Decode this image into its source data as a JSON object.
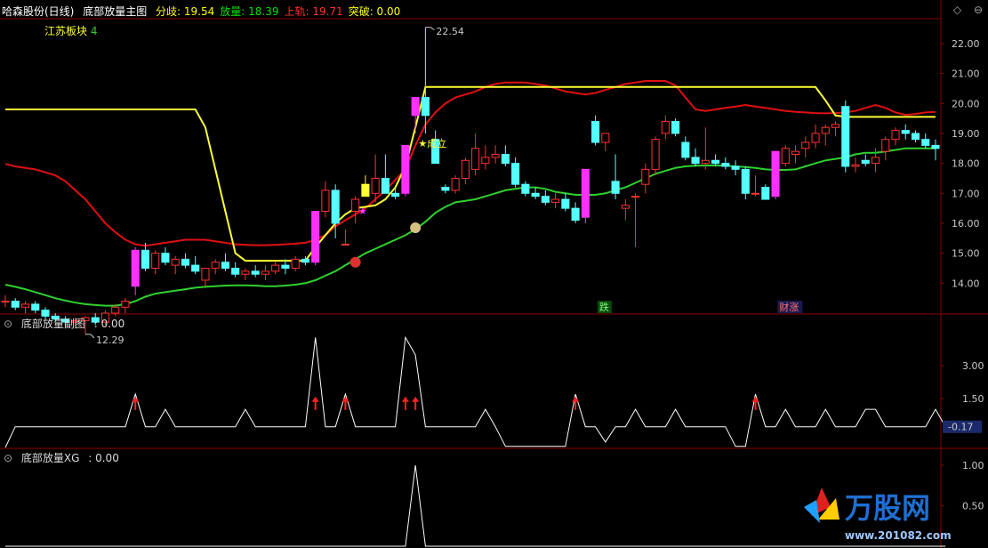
{
  "header": {
    "stock_name": "哈森股份(日线)",
    "indicator_name": "底部放量主图",
    "labels": [
      {
        "name": "分歧",
        "value": "19.54",
        "color": "#ffff00"
      },
      {
        "name": "放量",
        "value": "18.39",
        "color": "#00e000"
      },
      {
        "name": "上轨",
        "value": "19.71",
        "color": "#ff3030"
      },
      {
        "name": "突破",
        "value": "0.00",
        "color": "#ffff00"
      }
    ],
    "sector": "江苏板块",
    "sector_count": "4"
  },
  "panel2": {
    "title": "底部放量副图",
    "value": ": 0.00",
    "current_badge": "-0.17"
  },
  "panel3": {
    "title": "底部放量XG",
    "value": ": 0.00"
  },
  "annotations": {
    "high_label": "22.54",
    "low_label": "12.29",
    "chengli": "成立",
    "die": "跌",
    "caizhang": "财涨"
  },
  "watermark": {
    "brand": "万股网",
    "url": "www.201082.com"
  },
  "colors": {
    "up": "#ff3232",
    "down": "#54ffff",
    "bg": "#000000",
    "border": "#8b0000",
    "upper_band": "#e01010",
    "lower_band": "#30d030",
    "yellow_line": "#ffff33",
    "signal_bar": "#ff30ff"
  },
  "chart_data": [
    {
      "type": "candlestick",
      "title": "底部放量主图",
      "ylim": [
        13.0,
        22.8
      ],
      "yticks": [
        "22.00",
        "21.00",
        "20.00",
        "19.00",
        "18.00",
        "17.00",
        "16.00",
        "15.00",
        "14.00"
      ],
      "candles": [
        {
          "o": 13.4,
          "h": 13.6,
          "l": 13.2,
          "c": 13.4
        },
        {
          "o": 13.4,
          "h": 13.5,
          "l": 13.1,
          "c": 13.2
        },
        {
          "o": 13.2,
          "h": 13.4,
          "l": 13.0,
          "c": 13.3
        },
        {
          "o": 13.3,
          "h": 13.4,
          "l": 13.0,
          "c": 13.1
        },
        {
          "o": 13.1,
          "h": 13.2,
          "l": 12.8,
          "c": 12.9
        },
        {
          "o": 12.9,
          "h": 13.0,
          "l": 12.7,
          "c": 12.8
        },
        {
          "o": 12.8,
          "h": 12.9,
          "l": 12.6,
          "c": 12.7
        },
        {
          "o": 12.7,
          "h": 12.85,
          "l": 12.5,
          "c": 12.75
        },
        {
          "o": 12.75,
          "h": 12.9,
          "l": 12.29,
          "c": 12.85
        },
        {
          "o": 12.85,
          "h": 13.0,
          "l": 12.6,
          "c": 12.7
        },
        {
          "o": 12.7,
          "h": 13.1,
          "l": 12.6,
          "c": 13.0
        },
        {
          "o": 13.0,
          "h": 13.3,
          "l": 12.9,
          "c": 13.2
        },
        {
          "o": 13.2,
          "h": 13.5,
          "l": 13.0,
          "c": 13.4
        },
        {
          "o": 13.9,
          "h": 15.2,
          "l": 13.6,
          "c": 15.1,
          "signal": true
        },
        {
          "o": 15.1,
          "h": 15.35,
          "l": 14.4,
          "c": 14.5
        },
        {
          "o": 14.5,
          "h": 15.1,
          "l": 14.3,
          "c": 15.0
        },
        {
          "o": 15.0,
          "h": 15.2,
          "l": 14.6,
          "c": 14.7
        },
        {
          "o": 14.6,
          "h": 14.9,
          "l": 14.3,
          "c": 14.8
        },
        {
          "o": 14.8,
          "h": 15.0,
          "l": 14.5,
          "c": 14.6
        },
        {
          "o": 14.6,
          "h": 14.9,
          "l": 14.3,
          "c": 14.4
        },
        {
          "o": 14.1,
          "h": 14.5,
          "l": 13.9,
          "c": 14.5
        },
        {
          "o": 14.5,
          "h": 14.8,
          "l": 14.3,
          "c": 14.7
        },
        {
          "o": 14.7,
          "h": 15.0,
          "l": 14.4,
          "c": 14.5
        },
        {
          "o": 14.5,
          "h": 14.7,
          "l": 14.2,
          "c": 14.3
        },
        {
          "o": 14.3,
          "h": 14.5,
          "l": 14.1,
          "c": 14.4
        },
        {
          "o": 14.4,
          "h": 14.6,
          "l": 14.2,
          "c": 14.3
        },
        {
          "o": 14.3,
          "h": 14.6,
          "l": 14.1,
          "c": 14.4
        },
        {
          "o": 14.4,
          "h": 14.7,
          "l": 14.3,
          "c": 14.6
        },
        {
          "o": 14.6,
          "h": 14.8,
          "l": 14.3,
          "c": 14.5
        },
        {
          "o": 14.5,
          "h": 14.9,
          "l": 14.4,
          "c": 14.8
        },
        {
          "o": 14.8,
          "h": 14.9,
          "l": 14.6,
          "c": 14.7
        },
        {
          "o": 14.7,
          "h": 15.9,
          "l": 14.6,
          "c": 16.4,
          "signal": true
        },
        {
          "o": 16.4,
          "h": 17.4,
          "l": 16.2,
          "c": 17.1
        },
        {
          "o": 17.1,
          "h": 17.3,
          "l": 15.5,
          "c": 16.0
        },
        {
          "o": 15.3,
          "h": 15.8,
          "l": 15.3,
          "c": 15.3
        },
        {
          "o": 16.4,
          "h": 16.9,
          "l": 16.0,
          "c": 16.8
        },
        {
          "o": 17.3,
          "h": 17.6,
          "l": 16.9,
          "c": 16.9,
          "yellow": true
        },
        {
          "o": 17.0,
          "h": 18.3,
          "l": 16.7,
          "c": 17.5
        },
        {
          "o": 17.5,
          "h": 18.3,
          "l": 17.0,
          "c": 17.0
        },
        {
          "o": 17.0,
          "h": 17.2,
          "l": 16.8,
          "c": 16.9
        },
        {
          "o": 17.0,
          "h": 18.6,
          "l": 16.9,
          "c": 18.6,
          "signal": true
        },
        {
          "o": 19.6,
          "h": 20.2,
          "l": 19.0,
          "c": 20.2,
          "signal": true
        },
        {
          "o": 20.2,
          "h": 22.54,
          "l": 19.0,
          "c": 19.6
        },
        {
          "o": 18.8,
          "h": 19.1,
          "l": 18.0,
          "c": 18.0
        },
        {
          "o": 17.2,
          "h": 17.3,
          "l": 17.0,
          "c": 17.1
        },
        {
          "o": 17.1,
          "h": 17.6,
          "l": 17.0,
          "c": 17.5
        },
        {
          "o": 17.5,
          "h": 18.2,
          "l": 17.3,
          "c": 18.1
        },
        {
          "o": 17.8,
          "h": 19.0,
          "l": 17.6,
          "c": 18.5
        },
        {
          "o": 18.0,
          "h": 18.6,
          "l": 17.8,
          "c": 18.2
        },
        {
          "o": 18.2,
          "h": 18.6,
          "l": 18.0,
          "c": 18.3
        },
        {
          "o": 18.3,
          "h": 18.6,
          "l": 17.9,
          "c": 18.0
        },
        {
          "o": 18.0,
          "h": 18.2,
          "l": 17.2,
          "c": 17.3
        },
        {
          "o": 17.3,
          "h": 17.4,
          "l": 16.9,
          "c": 17.0
        },
        {
          "o": 17.0,
          "h": 17.2,
          "l": 16.8,
          "c": 16.9
        },
        {
          "o": 16.9,
          "h": 17.1,
          "l": 16.6,
          "c": 16.7
        },
        {
          "o": 16.7,
          "h": 17.0,
          "l": 16.5,
          "c": 16.8
        },
        {
          "o": 16.8,
          "h": 17.0,
          "l": 16.4,
          "c": 16.5
        },
        {
          "o": 16.5,
          "h": 16.7,
          "l": 16.0,
          "c": 16.1
        },
        {
          "o": 16.2,
          "h": 17.8,
          "l": 16.0,
          "c": 17.8,
          "signal": true
        },
        {
          "o": 19.4,
          "h": 19.6,
          "l": 18.6,
          "c": 18.7
        },
        {
          "o": 18.7,
          "h": 19.0,
          "l": 18.4,
          "c": 19.0
        },
        {
          "o": 17.4,
          "h": 18.3,
          "l": 16.8,
          "c": 17.0
        },
        {
          "o": 16.5,
          "h": 16.8,
          "l": 16.1,
          "c": 16.6
        },
        {
          "o": 16.9,
          "h": 17.0,
          "l": 15.2,
          "c": 16.9
        },
        {
          "o": 17.3,
          "h": 18.0,
          "l": 17.0,
          "c": 17.8
        },
        {
          "o": 17.8,
          "h": 18.9,
          "l": 17.6,
          "c": 18.8
        },
        {
          "o": 19.0,
          "h": 19.6,
          "l": 18.8,
          "c": 19.4
        },
        {
          "o": 19.4,
          "h": 19.5,
          "l": 18.9,
          "c": 19.0
        },
        {
          "o": 18.7,
          "h": 18.9,
          "l": 18.1,
          "c": 18.2
        },
        {
          "o": 18.2,
          "h": 18.5,
          "l": 17.9,
          "c": 18.0
        },
        {
          "o": 18.0,
          "h": 19.2,
          "l": 17.8,
          "c": 18.1
        },
        {
          "o": 18.1,
          "h": 18.3,
          "l": 17.9,
          "c": 18.0
        },
        {
          "o": 18.0,
          "h": 18.2,
          "l": 17.8,
          "c": 17.9
        },
        {
          "o": 17.9,
          "h": 18.1,
          "l": 17.6,
          "c": 17.8
        },
        {
          "o": 17.8,
          "h": 17.9,
          "l": 16.8,
          "c": 17.0
        },
        {
          "o": 17.0,
          "h": 17.6,
          "l": 16.9,
          "c": 17.0
        },
        {
          "o": 17.2,
          "h": 17.3,
          "l": 16.8,
          "c": 16.8
        },
        {
          "o": 16.9,
          "h": 18.4,
          "l": 16.8,
          "c": 18.4,
          "signal": true
        },
        {
          "o": 18.0,
          "h": 18.6,
          "l": 17.9,
          "c": 18.5
        },
        {
          "o": 18.3,
          "h": 18.6,
          "l": 18.0,
          "c": 18.4
        },
        {
          "o": 18.5,
          "h": 18.9,
          "l": 18.2,
          "c": 18.7
        },
        {
          "o": 18.7,
          "h": 19.3,
          "l": 18.5,
          "c": 19.0
        },
        {
          "o": 19.0,
          "h": 19.3,
          "l": 18.6,
          "c": 19.2
        },
        {
          "o": 19.2,
          "h": 19.4,
          "l": 18.9,
          "c": 19.3
        },
        {
          "o": 19.9,
          "h": 20.1,
          "l": 17.7,
          "c": 17.9
        },
        {
          "o": 17.9,
          "h": 18.2,
          "l": 17.7,
          "c": 17.95
        },
        {
          "o": 18.1,
          "h": 18.3,
          "l": 17.9,
          "c": 18.0
        },
        {
          "o": 18.0,
          "h": 18.5,
          "l": 17.7,
          "c": 18.2
        },
        {
          "o": 18.4,
          "h": 18.9,
          "l": 18.1,
          "c": 18.8
        },
        {
          "o": 18.8,
          "h": 19.2,
          "l": 18.6,
          "c": 19.1
        },
        {
          "o": 19.1,
          "h": 19.3,
          "l": 18.8,
          "c": 19.0
        },
        {
          "o": 19.0,
          "h": 19.1,
          "l": 18.7,
          "c": 18.8
        },
        {
          "o": 18.8,
          "h": 19.0,
          "l": 18.5,
          "c": 18.6
        },
        {
          "o": 18.6,
          "h": 18.8,
          "l": 18.1,
          "c": 18.5
        }
      ],
      "lower_band": [
        13.95,
        13.88,
        13.8,
        13.7,
        13.6,
        13.5,
        13.42,
        13.35,
        13.3,
        13.27,
        13.25,
        13.25,
        13.3,
        13.4,
        13.55,
        13.65,
        13.7,
        13.75,
        13.8,
        13.85,
        13.88,
        13.9,
        13.92,
        13.93,
        13.93,
        13.92,
        13.9,
        13.9,
        13.92,
        13.95,
        14.0,
        14.1,
        14.25,
        14.4,
        14.6,
        14.8,
        15.0,
        15.15,
        15.3,
        15.45,
        15.6,
        15.8,
        16.05,
        16.35,
        16.55,
        16.7,
        16.75,
        16.8,
        16.9,
        17.0,
        17.1,
        17.15,
        17.2,
        17.2,
        17.15,
        17.05,
        17.0,
        16.95,
        16.95,
        16.95,
        17.0,
        17.1,
        17.2,
        17.35,
        17.5,
        17.65,
        17.75,
        17.85,
        17.9,
        17.92,
        17.93,
        17.93,
        17.92,
        17.9,
        17.88,
        17.85,
        17.8,
        17.78,
        17.78,
        17.8,
        17.9,
        18.0,
        18.1,
        18.15,
        18.2,
        18.3,
        18.35,
        18.35,
        18.4,
        18.45,
        18.5,
        18.5,
        18.5,
        18.5
      ],
      "upper_band": [
        17.98,
        17.9,
        17.85,
        17.8,
        17.7,
        17.6,
        17.4,
        17.1,
        16.8,
        16.4,
        16.0,
        15.7,
        15.45,
        15.3,
        15.25,
        15.3,
        15.35,
        15.4,
        15.45,
        15.45,
        15.45,
        15.4,
        15.35,
        15.3,
        15.28,
        15.27,
        15.27,
        15.28,
        15.3,
        15.32,
        15.35,
        15.45,
        15.6,
        15.9,
        16.1,
        16.3,
        16.5,
        16.8,
        17.1,
        17.45,
        17.8,
        18.6,
        19.3,
        19.7,
        20.0,
        20.2,
        20.3,
        20.4,
        20.55,
        20.65,
        20.7,
        20.7,
        20.7,
        20.65,
        20.6,
        20.5,
        20.4,
        20.35,
        20.3,
        20.35,
        20.45,
        20.55,
        20.65,
        20.7,
        20.75,
        20.75,
        20.75,
        20.6,
        20.2,
        19.8,
        19.75,
        19.8,
        19.85,
        19.9,
        19.95,
        19.9,
        19.85,
        19.8,
        19.75,
        19.72,
        19.7,
        19.68,
        19.67,
        19.68,
        19.7,
        19.75,
        19.85,
        19.95,
        19.85,
        19.7,
        19.62,
        19.65,
        19.7,
        19.72
      ],
      "yellow_line": [
        19.8,
        19.8,
        19.8,
        19.8,
        19.8,
        19.8,
        19.8,
        19.8,
        19.8,
        19.8,
        19.8,
        19.8,
        19.8,
        19.8,
        19.8,
        19.8,
        19.8,
        19.8,
        19.8,
        19.8,
        19.2,
        17.8,
        16.4,
        15.0,
        14.75,
        14.75,
        14.75,
        14.75,
        14.75,
        14.75,
        14.75,
        15.2,
        15.6,
        16.0,
        16.3,
        16.5,
        16.55,
        16.6,
        16.8,
        17.2,
        17.9,
        19.2,
        20.55,
        20.55,
        20.55,
        20.55,
        20.55,
        20.55,
        20.55,
        20.55,
        20.55,
        20.55,
        20.55,
        20.55,
        20.55,
        20.55,
        20.55,
        20.55,
        20.55,
        20.55,
        20.55,
        20.55,
        20.55,
        20.55,
        20.55,
        20.55,
        20.55,
        20.55,
        20.55,
        20.55,
        20.55,
        20.55,
        20.55,
        20.55,
        20.55,
        20.55,
        20.55,
        20.55,
        20.55,
        20.55,
        20.55,
        20.55,
        20.1,
        19.6,
        19.55,
        19.55,
        19.55,
        19.55,
        19.55,
        19.55,
        19.55,
        19.55,
        19.55,
        19.55
      ]
    },
    {
      "type": "line",
      "title": "底部放量副图",
      "ylim": [
        -0.75,
        4.6
      ],
      "yticks": [
        "3.00",
        "1.50"
      ],
      "values": [
        -0.75,
        0.2,
        0.2,
        0.2,
        0.2,
        0.2,
        0.2,
        0.2,
        0.2,
        0.2,
        0.2,
        0.2,
        0.2,
        1.7,
        0.2,
        0.2,
        1.0,
        0.2,
        0.2,
        0.2,
        0.2,
        0.2,
        0.2,
        0.2,
        1.0,
        0.2,
        0.2,
        0.2,
        0.2,
        0.2,
        0.2,
        4.3,
        0.2,
        0.2,
        1.7,
        0.2,
        0.2,
        0.2,
        0.2,
        0.2,
        4.3,
        3.5,
        0.2,
        0.2,
        0.2,
        0.2,
        0.2,
        0.2,
        1.0,
        0.2,
        -0.7,
        -0.7,
        -0.7,
        -0.7,
        -0.7,
        -0.7,
        -0.7,
        1.7,
        0.2,
        0.2,
        -0.5,
        0.2,
        0.2,
        1.0,
        0.2,
        0.2,
        0.2,
        1.0,
        0.2,
        0.2,
        0.2,
        0.2,
        0.2,
        -0.7,
        -0.7,
        1.7,
        0.2,
        0.2,
        1.0,
        0.2,
        0.2,
        0.2,
        1.0,
        0.2,
        0.2,
        0.2,
        1.0,
        1.0,
        0.2,
        0.2,
        0.2,
        0.2,
        0.2,
        1.0,
        0.2,
        0.2
      ],
      "arrows": [
        13,
        31,
        34,
        40,
        41,
        57,
        75
      ]
    },
    {
      "type": "line",
      "title": "底部放量XG",
      "ylim": [
        0,
        1.0
      ],
      "yticks": [
        "1.00",
        "0.50"
      ],
      "values": [
        0,
        0,
        0,
        0,
        0,
        0,
        0,
        0,
        0,
        0,
        0,
        0,
        0,
        0,
        0,
        0,
        0,
        0,
        0,
        0,
        0,
        0,
        0,
        0,
        0,
        0,
        0,
        0,
        0,
        0,
        0,
        0,
        0,
        0,
        0,
        0,
        0,
        0,
        0,
        0,
        0,
        1.0,
        0,
        0,
        0,
        0,
        0,
        0,
        0,
        0,
        0,
        0,
        0,
        0,
        0,
        0,
        0,
        0,
        0,
        0,
        0,
        0,
        0,
        0,
        0,
        0,
        0,
        0,
        0,
        0,
        0,
        0,
        0,
        0,
        0,
        0,
        0,
        0,
        0,
        0,
        0,
        0,
        0,
        0,
        0,
        0,
        0,
        0,
        0,
        0,
        0,
        0,
        0,
        0,
        0
      ]
    }
  ]
}
